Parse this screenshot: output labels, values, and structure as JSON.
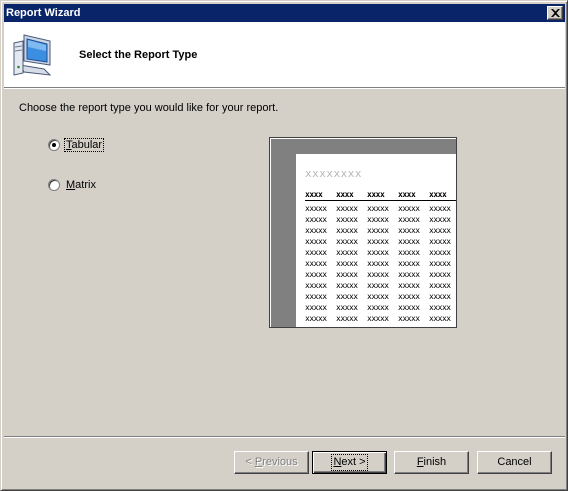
{
  "window": {
    "title": "Report Wizard"
  },
  "header": {
    "title": "Select the Report Type",
    "icon": "wizard-computer-icon"
  },
  "instructions": "Choose the report type you would like for your report.",
  "report_types": [
    {
      "prefix": "",
      "accel": "T",
      "rest": "abular",
      "selected": true
    },
    {
      "prefix": "",
      "accel": "M",
      "rest": "atrix",
      "selected": false
    }
  ],
  "preview": {
    "title": "xxxxxxxx",
    "header_cell": "xxxx",
    "cell": "xxxxx",
    "columns": 5,
    "rows": 11
  },
  "buttons": {
    "previous": {
      "prefix": "< ",
      "accel": "P",
      "rest": "revious",
      "enabled": false
    },
    "next": {
      "accel": "N",
      "rest": "ext >",
      "enabled": true
    },
    "finish": {
      "accel": "F",
      "rest": "inish",
      "enabled": true
    },
    "cancel": {
      "label": "Cancel",
      "enabled": true
    }
  }
}
